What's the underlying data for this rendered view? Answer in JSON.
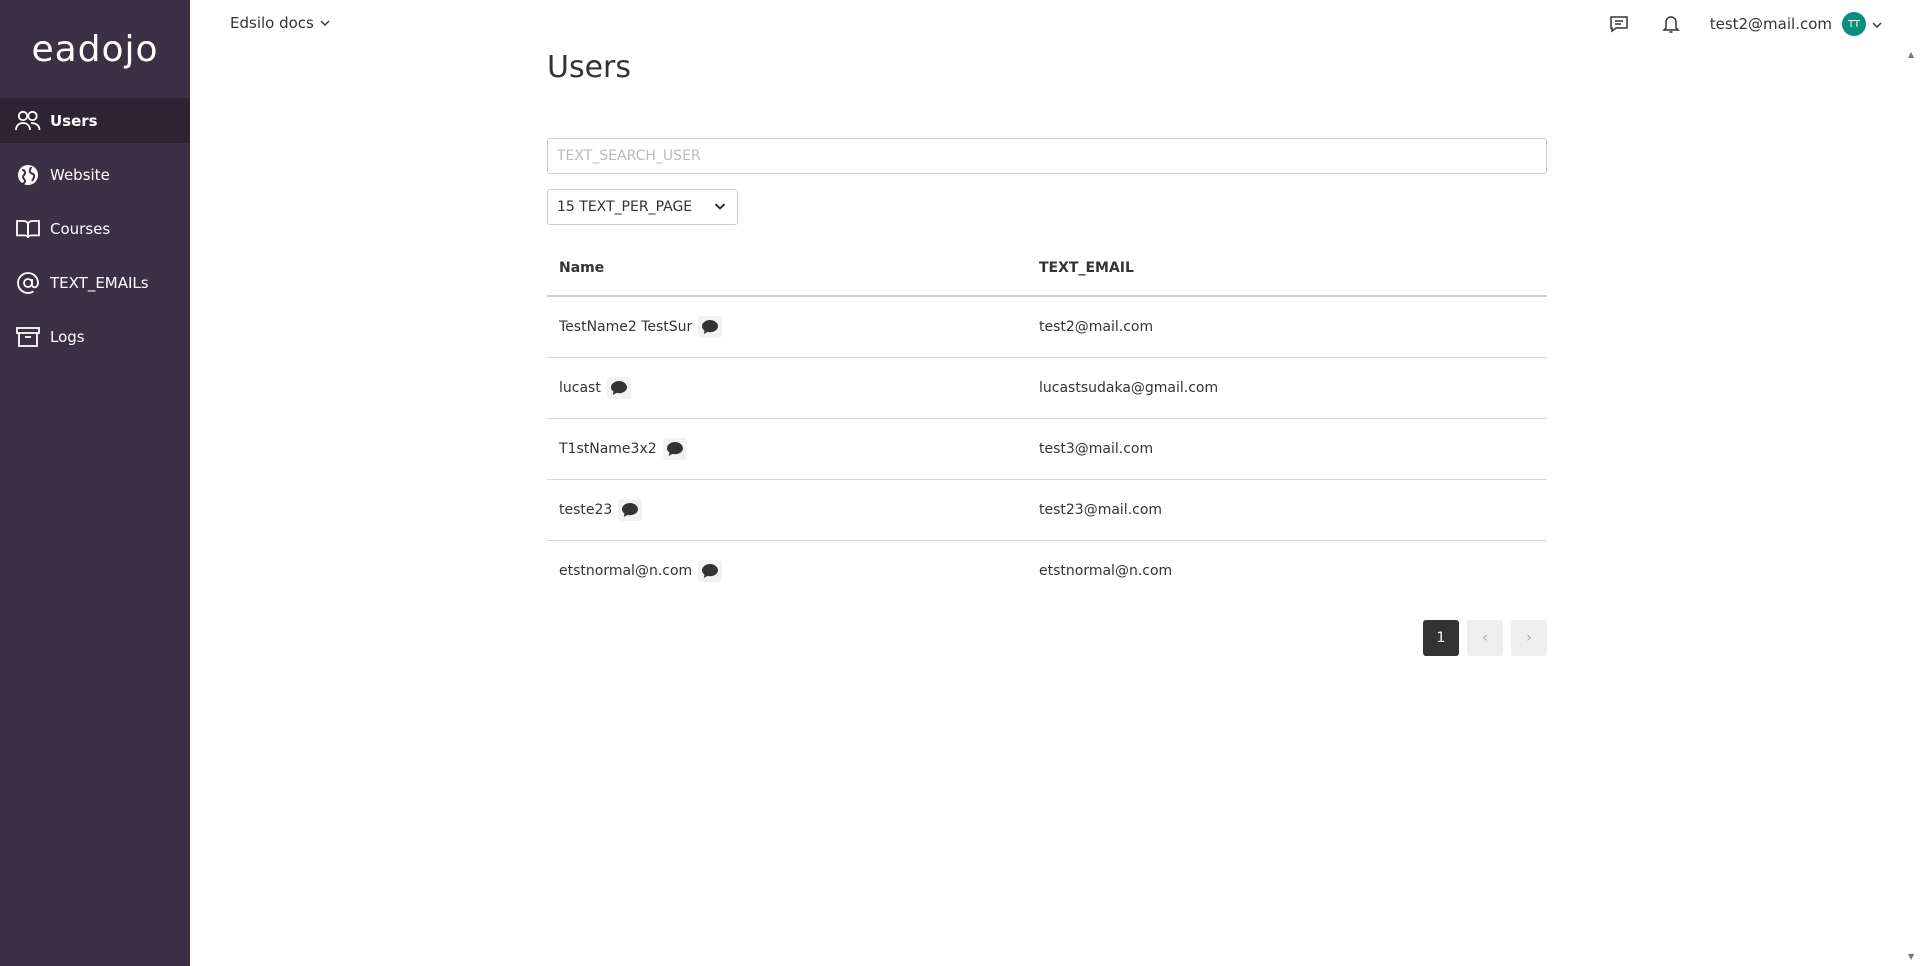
{
  "app": {
    "logo_text": "eadojo"
  },
  "sidebar": {
    "items": [
      {
        "label": "Users",
        "icon": "users-icon",
        "active": true
      },
      {
        "label": "Website",
        "icon": "globe-icon",
        "active": false
      },
      {
        "label": "Courses",
        "icon": "book-icon",
        "active": false
      },
      {
        "label": "TEXT_EMAILs",
        "icon": "at-icon",
        "active": false
      },
      {
        "label": "Logs",
        "icon": "archive-icon",
        "active": false
      }
    ]
  },
  "topbar": {
    "workspace": "Edsilo docs",
    "user_email": "test2@mail.com",
    "avatar_initials": "TT",
    "avatar_color": "#0a8f7d"
  },
  "main": {
    "title": "Users",
    "search": {
      "placeholder": "TEXT_SEARCH_USER",
      "value": ""
    },
    "per_page_label": "15 TEXT_PER_PAGE",
    "table": {
      "headers": [
        "Name",
        "TEXT_EMAIL"
      ],
      "rows": [
        {
          "name": "TestName2 TestSur",
          "email": "test2@mail.com"
        },
        {
          "name": "lucast",
          "email": "lucastsudaka@gmail.com"
        },
        {
          "name": "T1stName3x2",
          "email": "test3@mail.com"
        },
        {
          "name": "teste23",
          "email": "test23@mail.com"
        },
        {
          "name": "etstnormal@n.com",
          "email": "etstnormal@n.com"
        }
      ]
    },
    "pagination": {
      "current_page": "1",
      "prev_symbol": "‹",
      "next_symbol": "›"
    }
  },
  "colors": {
    "sidebar_bg": "#3b3144",
    "sidebar_active_bg": "#2c2433",
    "page_active_bg": "#333333"
  }
}
